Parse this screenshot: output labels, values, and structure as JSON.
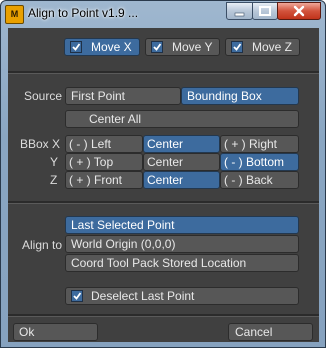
{
  "window": {
    "title": "Align to Point v1.9 ...",
    "icon_text": "M"
  },
  "toggles": [
    {
      "label": "Move X",
      "checked": true
    },
    {
      "label": "Move Y",
      "checked": true
    },
    {
      "label": "Move Z",
      "checked": true
    }
  ],
  "source": {
    "label": "Source",
    "options": [
      "First Point",
      "Bounding Box"
    ],
    "selected": "Bounding Box",
    "center_all": "Center All"
  },
  "bbox": {
    "rows": [
      {
        "label": "BBox X",
        "options": [
          "( - ) Left",
          "Center",
          "( + ) Right"
        ],
        "selected": "Center"
      },
      {
        "label": "Y",
        "options": [
          "( + ) Top",
          "Center",
          "( - ) Bottom"
        ],
        "selected": "( - ) Bottom"
      },
      {
        "label": "Z",
        "options": [
          "( + ) Front",
          "Center",
          "( - ) Back"
        ],
        "selected": "Center"
      }
    ]
  },
  "align_to": {
    "label": "Align to",
    "options": [
      "Last Selected Point",
      "World Origin (0,0,0)",
      "Coord Tool Pack Stored Location"
    ],
    "selected": "Last Selected Point"
  },
  "deselect": {
    "label": "Deselect Last Point",
    "checked": true
  },
  "footer": {
    "ok": "Ok",
    "cancel": "Cancel"
  },
  "colors": {
    "panel": "#404040",
    "button": "#575757",
    "selected": "#3d6b9e",
    "text": "#e8e8e8"
  }
}
